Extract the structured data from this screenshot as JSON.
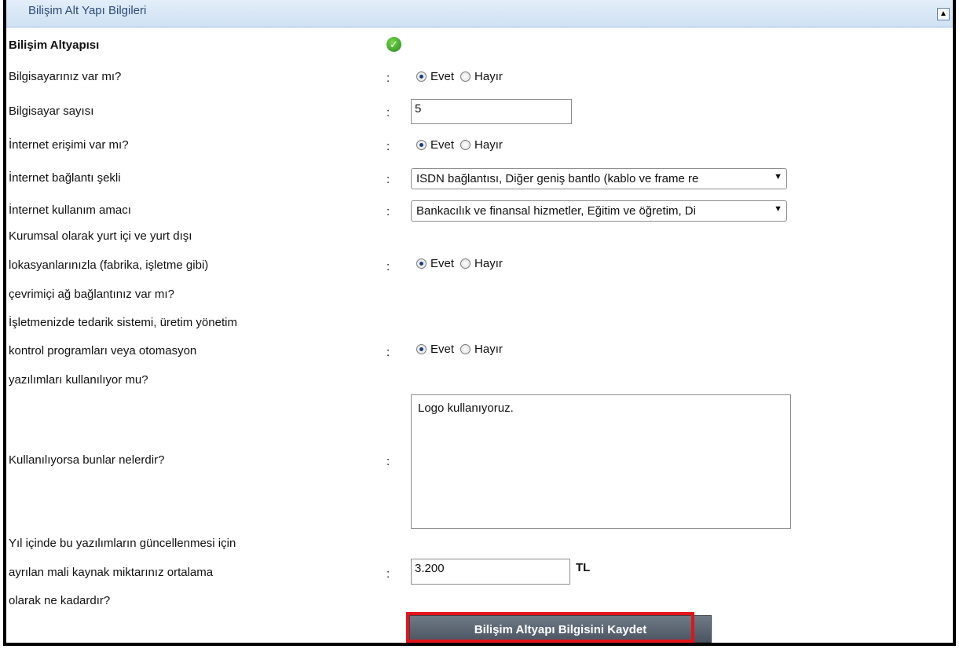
{
  "panel": {
    "title": "Bilişim Alt Yapı Bilgileri"
  },
  "section": {
    "title": "Bilişim Altyapısı"
  },
  "colon": ":",
  "radio_labels": {
    "yes": "Evet",
    "no": "Hayır"
  },
  "rows": {
    "has_computer": {
      "label": "Bilgisayarınız var mı?",
      "selected": "Evet"
    },
    "computer_count": {
      "label": "Bilgisayar sayısı",
      "value": "5"
    },
    "internet_access": {
      "label": "İnternet erişimi var mı?",
      "selected": "Evet"
    },
    "connection_type": {
      "label": "İnternet bağlantı şekli",
      "value": "ISDN bağlantısı, Diğer geniş bantlo (kablo ve frame re"
    },
    "usage_purpose": {
      "label": "İnternet kullanım amacı",
      "value": "Bankacılık ve finansal hizmetler, Eğitim ve öğretim, Di"
    },
    "network_connection": {
      "label_lines": [
        "Kurumsal olarak yurt içi ve yurt dışı",
        "lokasyanlarınızla (fabrika, işletme gibi)",
        "çevrimiçi ağ bağlantınız var mı?"
      ],
      "selected": "Evet"
    },
    "software_usage": {
      "label_lines": [
        "İşletmenizde tedarik sistemi, üretim yönetim",
        "kontrol programları veya otomasyon",
        "yazılımları kullanılıyor mu?"
      ],
      "selected": "Evet"
    },
    "software_names": {
      "label": "Kullanılıyorsa bunlar nelerdir?",
      "value": "Logo kullanıyoruz."
    },
    "update_budget": {
      "label_lines": [
        "Yıl içinde bu yazılımların güncellenmesi için",
        "ayrılan mali kaynak miktarınız ortalama",
        "olarak ne kadardır?"
      ],
      "value": "3.200",
      "unit": "TL"
    }
  },
  "save_button": {
    "label": "Bilişim Altyapı Bilgisini Kaydet"
  }
}
